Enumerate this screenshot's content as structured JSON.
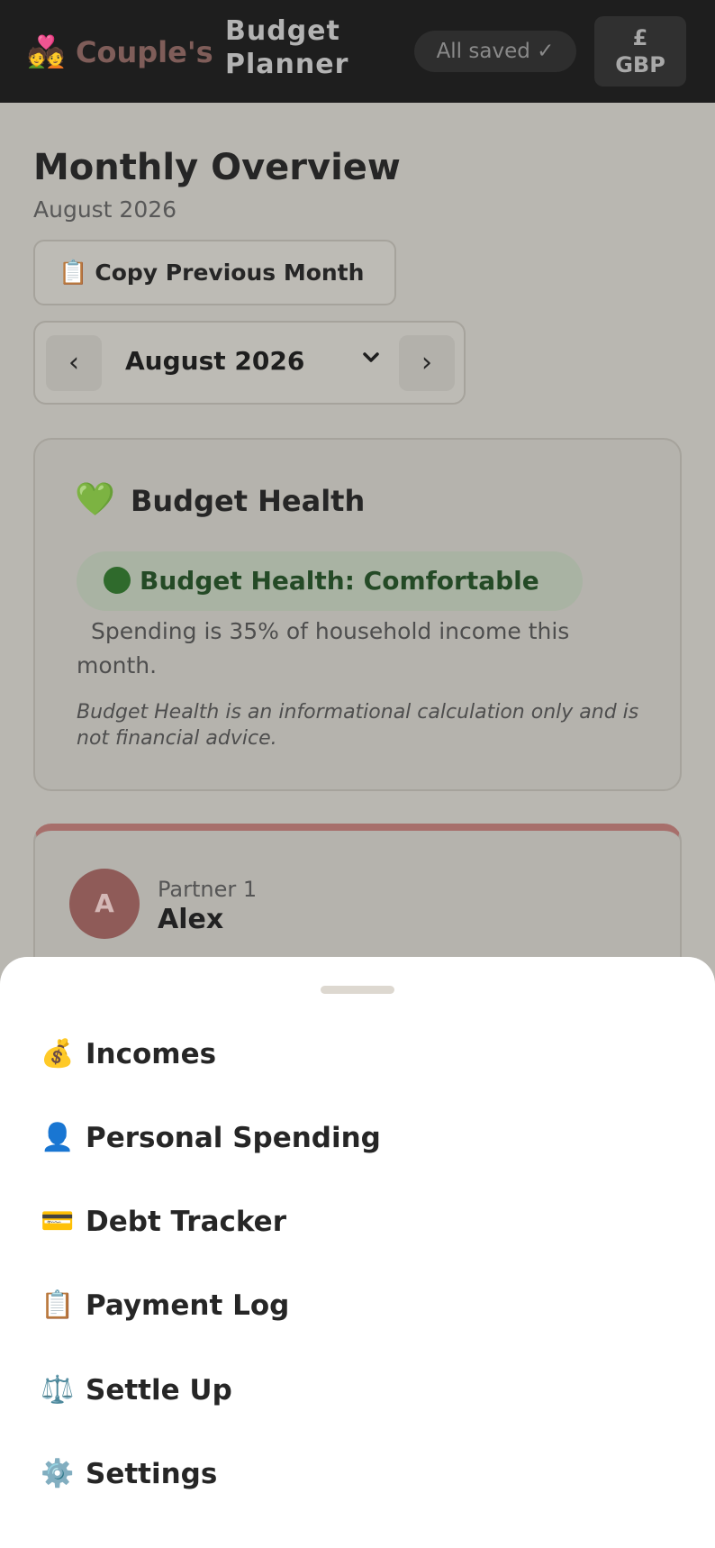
{
  "header": {
    "brand_emoji": "💑",
    "brand_name_1": "Couple's",
    "brand_name_2": "Budget Planner",
    "save_status": "All saved ✓",
    "currency_symbol": "£",
    "currency_code": "GBP"
  },
  "overview": {
    "title": "Monthly Overview",
    "subtitle": "August 2026",
    "copy_button_icon": "📋",
    "copy_button_label": "Copy Previous Month",
    "month_selector": {
      "prev": "‹",
      "selected": "August 2026",
      "dropdown": "⌄",
      "next": "›"
    }
  },
  "budget_health": {
    "icon": "💚",
    "title": "Budget Health",
    "status_label": "Budget Health: Comfortable",
    "status_color": "#2f6a2c",
    "description": "Spending is 35% of household income this month.",
    "disclaimer": "Budget Health is an informational calculation only and is not financial advice."
  },
  "partner": {
    "initial": "A",
    "role": "Partner 1",
    "name": "Alex",
    "accent_color": "#a76f6b"
  },
  "sheet_menu": {
    "items": [
      {
        "icon": "💰",
        "label": "Incomes"
      },
      {
        "icon": "👤",
        "label": "Personal Spending"
      },
      {
        "icon": "💳",
        "label": "Debt Tracker"
      },
      {
        "icon": "📋",
        "label": "Payment Log"
      },
      {
        "icon": "⚖️",
        "label": "Settle Up"
      },
      {
        "icon": "⚙️",
        "label": "Settings"
      }
    ]
  }
}
